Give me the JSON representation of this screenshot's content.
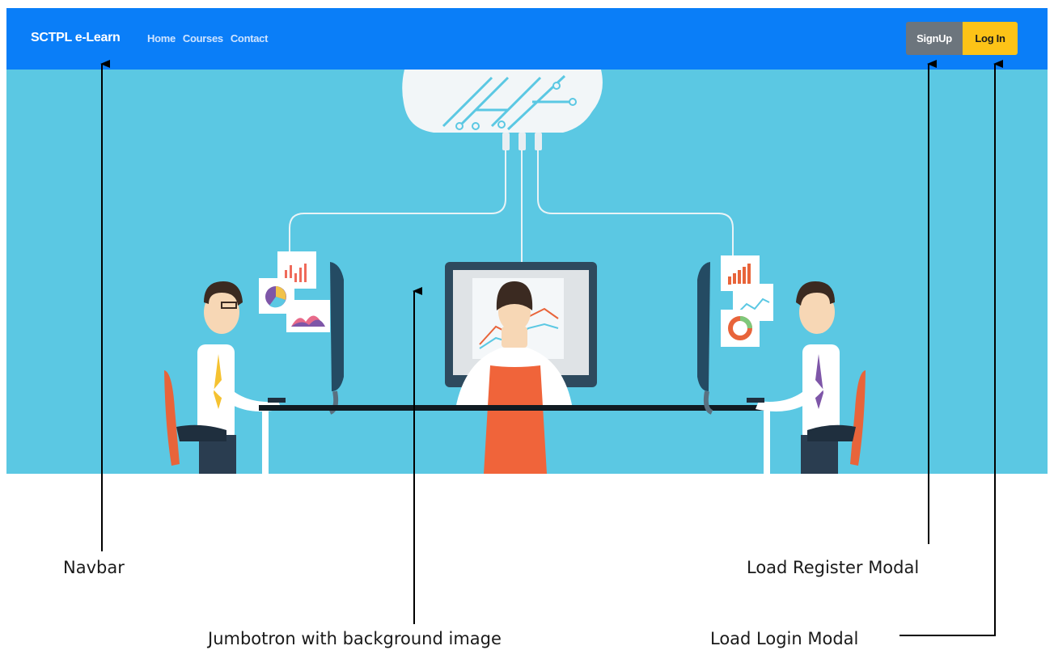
{
  "navbar": {
    "brand": "SCTPL e-Learn",
    "links": [
      {
        "label": "Home"
      },
      {
        "label": "Courses"
      },
      {
        "label": "Contact"
      }
    ],
    "signup_label": "SignUp",
    "login_label": "Log In",
    "colors": {
      "background": "#0a7ef8",
      "signup": "#6c757d",
      "login": "#fdc317"
    }
  },
  "jumbotron": {
    "background_color": "#5bc8e3",
    "illustration": "cloud-connected-workstations-illustration"
  },
  "annotations": {
    "navbar": "Navbar",
    "jumbotron": "Jumbotron with background image",
    "signup": "Load Register Modal",
    "login": "Load Login Modal"
  }
}
